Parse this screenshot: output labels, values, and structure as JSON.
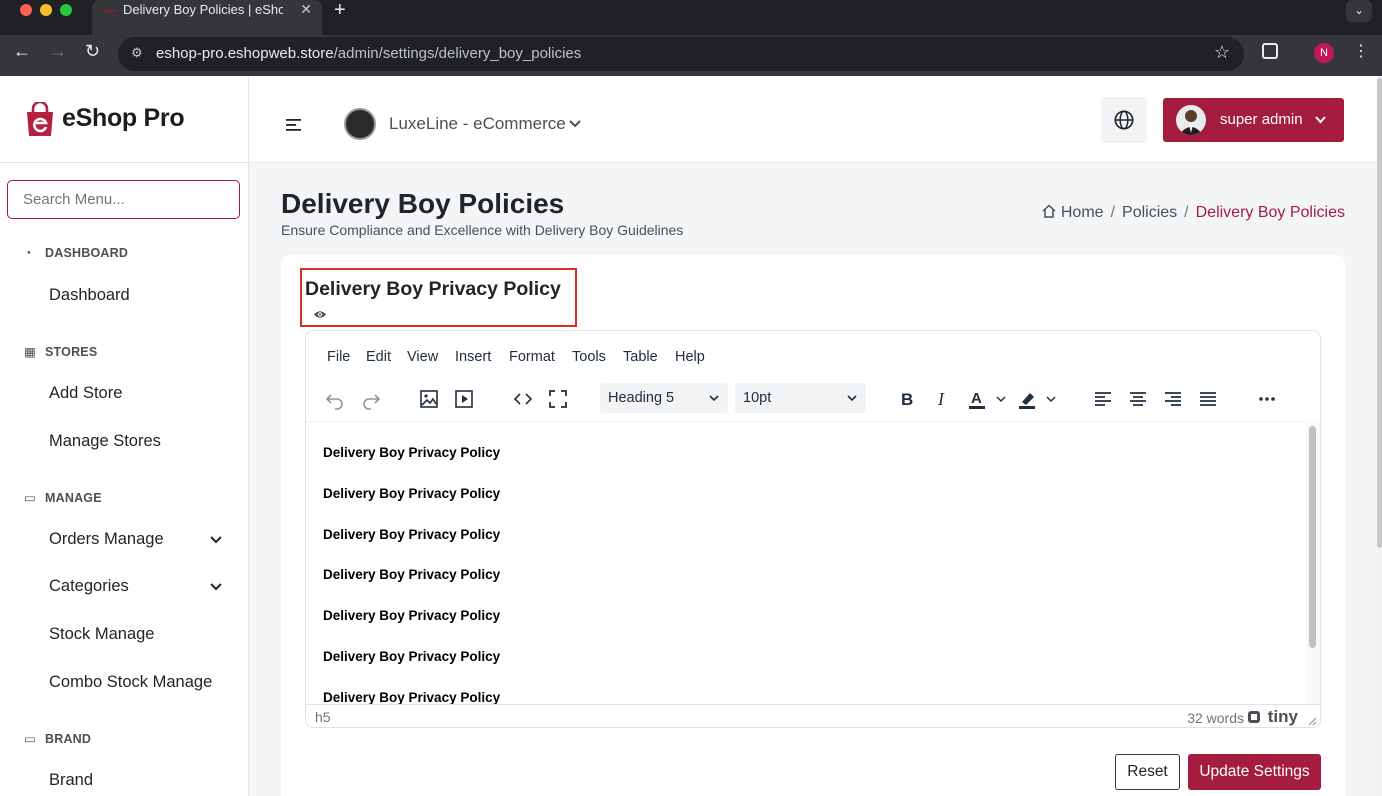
{
  "browser": {
    "tab_title": "Delivery Boy Policies | eShop",
    "url_host": "eshop-pro.eshopweb.store",
    "url_path": "/admin/settings/delivery_boy_policies",
    "profile_initial": "N"
  },
  "sidebar": {
    "brand": "eShop Pro",
    "search_placeholder": "Search Menu...",
    "sections": {
      "dashboard": {
        "title": "DASHBOARD",
        "items": [
          "Dashboard"
        ]
      },
      "stores": {
        "title": "STORES",
        "items": [
          "Add Store",
          "Manage Stores"
        ]
      },
      "manage": {
        "title": "MANAGE",
        "items": [
          "Orders Manage",
          "Categories",
          "Stock Manage",
          "Combo Stock Manage"
        ]
      },
      "brand": {
        "title": "BRAND",
        "items": [
          "Brand"
        ]
      }
    }
  },
  "header": {
    "store_name": "LuxeLine - eCommerce",
    "user_name": "super admin"
  },
  "page": {
    "title": "Delivery Boy Policies",
    "subtitle": "Ensure Compliance and Excellence with Delivery Boy Guidelines",
    "breadcrumb": [
      "Home",
      "Policies",
      "Delivery Boy Policies"
    ]
  },
  "policy": {
    "title": "Delivery Boy Privacy Policy"
  },
  "editor": {
    "menu": [
      "File",
      "Edit",
      "View",
      "Insert",
      "Format",
      "Tools",
      "Table",
      "Help"
    ],
    "block_format": "Heading 5",
    "font_size": "10pt",
    "content_lines": [
      "Delivery Boy Privacy Policy",
      "Delivery Boy Privacy Policy",
      "Delivery Boy Privacy Policy",
      "Delivery Boy Privacy Policy",
      "Delivery Boy Privacy Policy",
      "Delivery Boy Privacy Policy",
      "Delivery Boy Privacy Policy"
    ],
    "status_path": "h5",
    "word_count": "32 words",
    "branding": "tiny"
  },
  "actions": {
    "reset": "Reset",
    "update": "Update Settings"
  },
  "colors": {
    "accent": "#a51c41",
    "highlight_border": "#d0331f"
  }
}
